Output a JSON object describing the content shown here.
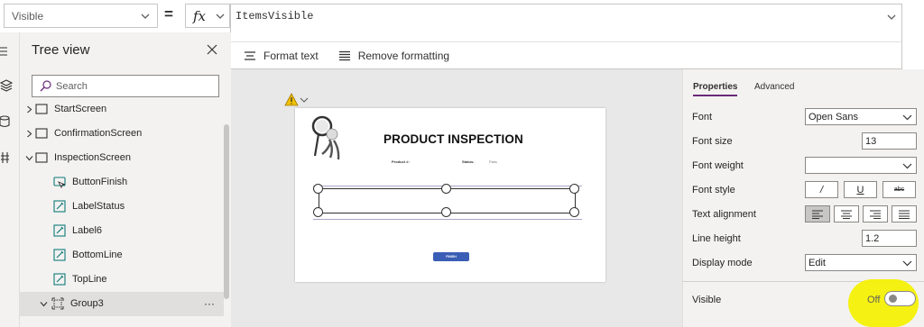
{
  "formula_bar": {
    "property": "Visible",
    "fx_label": "fx",
    "formula": "ItemsVisible",
    "format_text": "Format text",
    "remove_formatting": "Remove formatting"
  },
  "tree_view": {
    "title": "Tree view",
    "search_placeholder": "Search",
    "items": [
      {
        "label": "StartScreen",
        "type": "screen",
        "expander": "collapsed"
      },
      {
        "label": "ConfirmationScreen",
        "type": "screen",
        "expander": "collapsed"
      },
      {
        "label": "InspectionScreen",
        "type": "screen",
        "expander": "expanded"
      },
      {
        "label": "ButtonFinish",
        "type": "button"
      },
      {
        "label": "LabelStatus",
        "type": "label"
      },
      {
        "label": "Label6",
        "type": "label"
      },
      {
        "label": "BottomLine",
        "type": "label"
      },
      {
        "label": "TopLine",
        "type": "label"
      },
      {
        "label": "Group3",
        "type": "group",
        "expander": "expanded",
        "selected": true,
        "more": "···"
      }
    ]
  },
  "canvas": {
    "title": "PRODUCT INSPECTION",
    "product_label": "Product #:",
    "status_label": "Status:",
    "status_value": "Pass",
    "finish_button": "FINISH"
  },
  "properties": {
    "tabs": [
      "Properties",
      "Advanced"
    ],
    "active_tab": "Properties",
    "font_label": "Font",
    "font_value": "Open Sans",
    "font_size_label": "Font size",
    "font_size_value": "13",
    "font_weight_label": "Font weight",
    "font_weight_value": "",
    "font_style_label": "Font style",
    "font_style_buttons": [
      "/",
      "U",
      "abc"
    ],
    "text_alignment_label": "Text alignment",
    "line_height_label": "Line height",
    "line_height_value": "1.2",
    "display_mode_label": "Display mode",
    "display_mode_value": "Edit",
    "visible_label": "Visible",
    "visible_toggle": "Off"
  },
  "colors": {
    "highlight": "#f5f200",
    "accent": "#6b2a7a",
    "finish_button": "#3a5db5"
  }
}
